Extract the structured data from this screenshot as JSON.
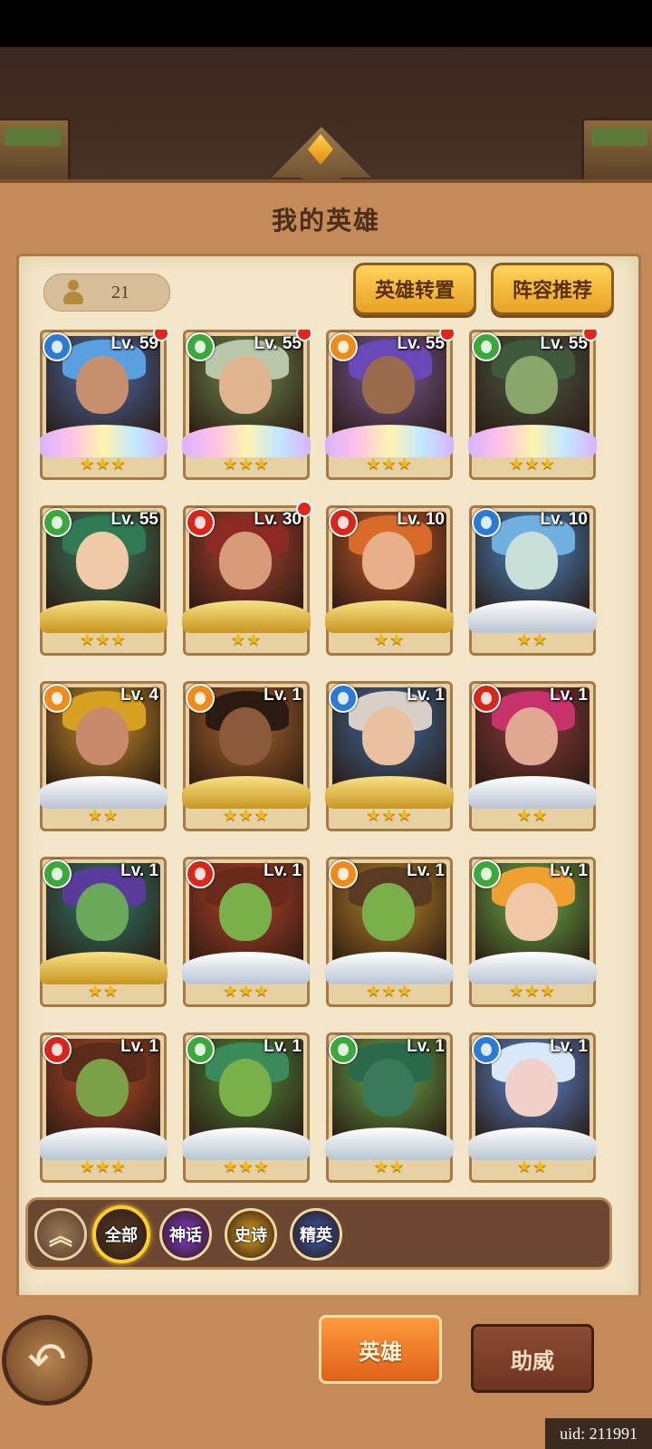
{
  "title": "我的英雄",
  "hero_count": "21",
  "buttons": {
    "transfer": "英雄转置",
    "recommend": "阵容推荐"
  },
  "heroes": [
    {
      "level": "Lv. 59",
      "element": "water",
      "stars": "★★★",
      "frame": "rainbow",
      "new": true,
      "skin": "#c68f6d",
      "hair": "#5a9fe0",
      "bg": "#4b6aa8"
    },
    {
      "level": "Lv. 55",
      "element": "wind",
      "stars": "★★★",
      "frame": "rainbow",
      "new": true,
      "skin": "#e0b48e",
      "hair": "#b8c7a8",
      "bg": "#6f8a4e"
    },
    {
      "level": "Lv. 55",
      "element": "earth",
      "stars": "★★★",
      "frame": "rainbow",
      "new": true,
      "skin": "#9a6a4c",
      "hair": "#6a48b8",
      "bg": "#7a5a9a"
    },
    {
      "level": "Lv. 55",
      "element": "wind",
      "stars": "★★★",
      "frame": "rainbow",
      "new": true,
      "skin": "#8aa66a",
      "hair": "#3e5a3a",
      "bg": "#4c5a45"
    },
    {
      "level": "Lv. 55",
      "element": "wind",
      "stars": "★★★",
      "frame": "gold",
      "new": false,
      "skin": "#f0c9a8",
      "hair": "#2f7a55",
      "bg": "#3f7a5a"
    },
    {
      "level": "Lv. 30",
      "element": "fire",
      "stars": "★★",
      "frame": "gold",
      "new": true,
      "skin": "#d89a78",
      "hair": "#8a2a22",
      "bg": "#a8422f"
    },
    {
      "level": "Lv. 10",
      "element": "fire",
      "stars": "★★",
      "frame": "gold",
      "new": false,
      "skin": "#e8b08a",
      "hair": "#d86a2a",
      "bg": "#c25a2a"
    },
    {
      "level": "Lv. 10",
      "element": "water",
      "stars": "★★",
      "frame": "silver",
      "new": false,
      "skin": "#c8e0d8",
      "hair": "#6fb0e0",
      "bg": "#4a8ac8"
    },
    {
      "level": "Lv. 4",
      "element": "earth",
      "stars": "★★",
      "frame": "silver",
      "new": false,
      "skin": "#c88a6a",
      "hair": "#d8a020",
      "bg": "#c28a2a"
    },
    {
      "level": "Lv. 1",
      "element": "earth",
      "stars": "★★★",
      "frame": "gold",
      "new": false,
      "skin": "#8a5a3a",
      "hair": "#2a1a12",
      "bg": "#a8642a"
    },
    {
      "level": "Lv. 1",
      "element": "water",
      "stars": "★★★",
      "frame": "gold",
      "new": false,
      "skin": "#e8c0a0",
      "hair": "#d8d0c8",
      "bg": "#3f6aa0"
    },
    {
      "level": "Lv. 1",
      "element": "fire",
      "stars": "★★",
      "frame": "silver",
      "new": false,
      "skin": "#e0a890",
      "hair": "#c8326a",
      "bg": "#8a3a3a"
    },
    {
      "level": "Lv. 1",
      "element": "wind",
      "stars": "★★",
      "frame": "gold",
      "new": false,
      "skin": "#6aa85a",
      "hair": "#5a3a9a",
      "bg": "#2f7a6a"
    },
    {
      "level": "Lv. 1",
      "element": "fire",
      "stars": "★★★",
      "frame": "silver",
      "new": false,
      "skin": "#7ab04a",
      "hair": "#6a2a1a",
      "bg": "#b8422a"
    },
    {
      "level": "Lv. 1",
      "element": "earth",
      "stars": "★★★",
      "frame": "silver",
      "new": false,
      "skin": "#7ab04a",
      "hair": "#5a3a22",
      "bg": "#b8842a"
    },
    {
      "level": "Lv. 1",
      "element": "wind",
      "stars": "★★★",
      "frame": "silver",
      "new": false,
      "skin": "#f0c8a8",
      "hair": "#f0a030",
      "bg": "#6ab04a"
    },
    {
      "level": "Lv. 1",
      "element": "fire",
      "stars": "★★★",
      "frame": "silver",
      "new": false,
      "skin": "#7aa048",
      "hair": "#5a2a1a",
      "bg": "#b84a2a"
    },
    {
      "level": "Lv. 1",
      "element": "wind",
      "stars": "★★★",
      "frame": "silver",
      "new": false,
      "skin": "#7ab04a",
      "hair": "#3a8a5a",
      "bg": "#4f8a3a"
    },
    {
      "level": "Lv. 1",
      "element": "wind",
      "stars": "★★",
      "frame": "silver",
      "new": false,
      "skin": "#3a7a5a",
      "hair": "#2a6a4a",
      "bg": "#6aa84a"
    },
    {
      "level": "Lv. 1",
      "element": "water",
      "stars": "★★",
      "frame": "silver",
      "new": false,
      "skin": "#f0d0c8",
      "hair": "#d8e8f8",
      "bg": "#5a8ad8"
    }
  ],
  "element_colors": {
    "water": "#2a7ad8",
    "wind": "#3aa83a",
    "earth": "#f08a1a",
    "fire": "#d8261a"
  },
  "filters": [
    {
      "label": "全部",
      "active": true,
      "color": "#5a3e28"
    },
    {
      "label": "神话",
      "active": false,
      "color": "#8a3ad0"
    },
    {
      "label": "史诗",
      "active": false,
      "color": "#e0a020"
    },
    {
      "label": "精英",
      "active": false,
      "color": "#3a5ab0"
    }
  ],
  "collapse_icon": "double-chevron-up-icon",
  "tabs": {
    "heroes": "英雄",
    "support": "助威"
  },
  "uid": "uid: 211991"
}
